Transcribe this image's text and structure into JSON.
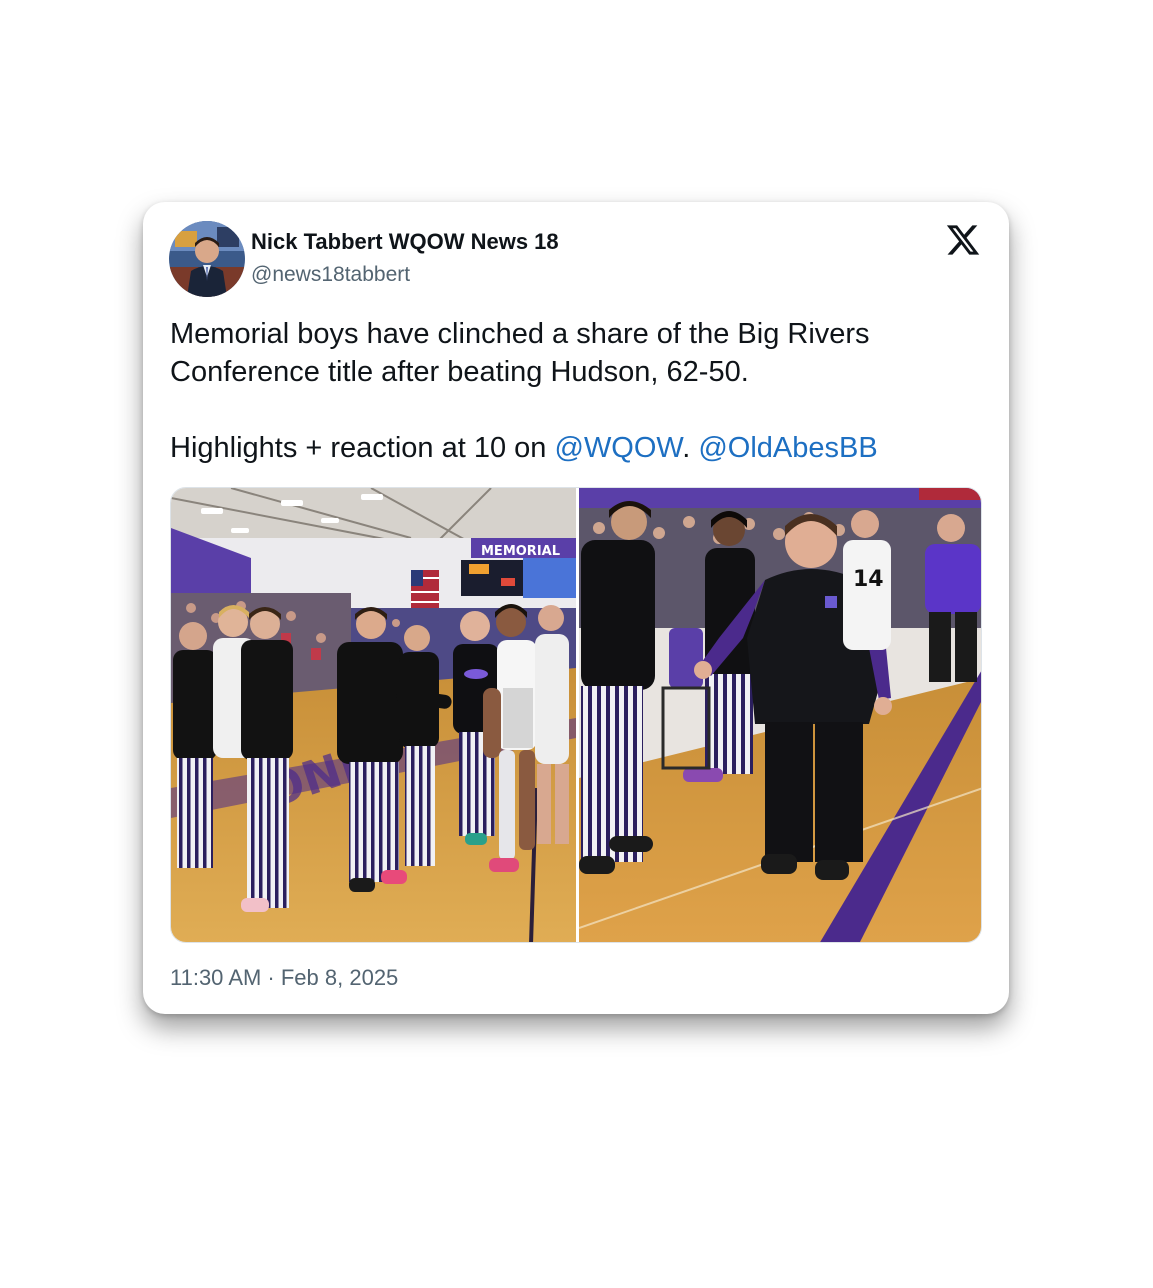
{
  "author": {
    "display_name": "Nick Tabbert WQOW News 18",
    "handle": "@news18tabbert"
  },
  "platform_icon": "x-logo-icon",
  "tweet": {
    "line_1": "Memorial boys have clinched a share of the Big Rivers Conference title after beating Hudson, 62-50.",
    "line_2_prefix": "Highlights + reaction at 10 on ",
    "mention_1": "@WQOW",
    "separator": ". ",
    "mention_2": "@OldAbesBB"
  },
  "media": {
    "photo_1": {
      "scoreboard_text": "MEMORIAL",
      "floor_text": "ONE"
    },
    "photo_2": {
      "jersey_number": "14"
    }
  },
  "colors": {
    "text": "#0f1419",
    "secondary": "#536471",
    "link": "#1d6fc2",
    "team_purple": "#4b2a8c",
    "floor_wood": "#d49a3a"
  },
  "timestamp": "11:30 AM · Feb 8, 2025"
}
